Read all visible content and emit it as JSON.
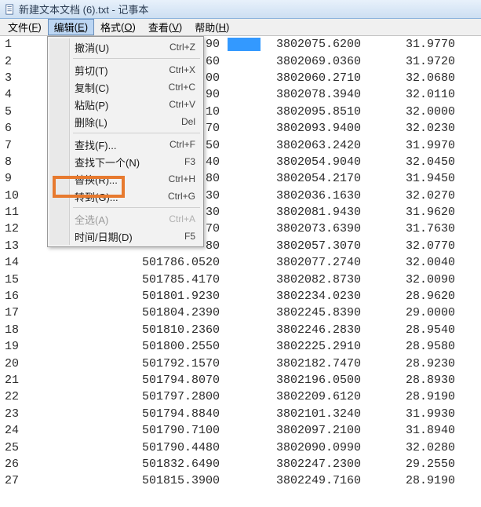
{
  "window": {
    "title": "新建文本文档 (6).txt - 记事本"
  },
  "menubar": {
    "file": {
      "label": "文件",
      "mn": "F"
    },
    "edit": {
      "label": "编辑",
      "mn": "E"
    },
    "format": {
      "label": "格式",
      "mn": "O"
    },
    "view": {
      "label": "查看",
      "mn": "V"
    },
    "help": {
      "label": "帮助",
      "mn": "H"
    }
  },
  "edit_menu": {
    "undo": {
      "label": "撤消(U)",
      "accel": "Ctrl+Z",
      "enabled": true
    },
    "cut": {
      "label": "剪切(T)",
      "accel": "Ctrl+X",
      "enabled": true
    },
    "copy": {
      "label": "复制(C)",
      "accel": "Ctrl+C",
      "enabled": true
    },
    "paste": {
      "label": "粘贴(P)",
      "accel": "Ctrl+V",
      "enabled": true
    },
    "delete": {
      "label": "删除(L)",
      "accel": "Del",
      "enabled": true
    },
    "find": {
      "label": "查找(F)...",
      "accel": "Ctrl+F",
      "enabled": true
    },
    "findnext": {
      "label": "查找下一个(N)",
      "accel": "F3",
      "enabled": true
    },
    "replace": {
      "label": "替换(R)...",
      "accel": "Ctrl+H",
      "enabled": true
    },
    "goto": {
      "label": "转到(G)...",
      "accel": "Ctrl+G",
      "enabled": true
    },
    "selectall": {
      "label": "全选(A)",
      "accel": "Ctrl+A",
      "enabled": false
    },
    "timedate": {
      "label": "时间/日期(D)",
      "accel": "F5",
      "enabled": true
    }
  },
  "rows": [
    {
      "n": "1",
      "c1": "90",
      "c2": "3802075.6200",
      "c3": "31.9770",
      "sel": true
    },
    {
      "n": "2",
      "c1": "60",
      "c2": "3802069.0360",
      "c3": "31.9720"
    },
    {
      "n": "3",
      "c1": "00",
      "c2": "3802060.2710",
      "c3": "32.0680"
    },
    {
      "n": "4",
      "c1": "90",
      "c2": "3802078.3940",
      "c3": "32.0110"
    },
    {
      "n": "5",
      "c1": "10",
      "c2": "3802095.8510",
      "c3": "32.0000"
    },
    {
      "n": "6",
      "c1": "70",
      "c2": "3802093.9400",
      "c3": "32.0230"
    },
    {
      "n": "7",
      "c1": "50",
      "c2": "3802063.2420",
      "c3": "31.9970"
    },
    {
      "n": "8",
      "c1": "40",
      "c2": "3802054.9040",
      "c3": "32.0450"
    },
    {
      "n": "9",
      "c1": "80",
      "c2": "3802054.2170",
      "c3": "31.9450"
    },
    {
      "n": "10",
      "c1": "30",
      "c2": "3802036.1630",
      "c3": "32.0270"
    },
    {
      "n": "11",
      "c1": "30",
      "c2": "3802081.9430",
      "c3": "31.9620"
    },
    {
      "n": "12",
      "c1": "70",
      "c2": "3802073.6390",
      "c3": "31.7630"
    },
    {
      "n": "13",
      "c1": "80",
      "c2": "3802057.3070",
      "c3": "32.0770"
    },
    {
      "n": "14",
      "c1": "501786.0520",
      "c2": "3802077.2740",
      "c3": "32.0040"
    },
    {
      "n": "15",
      "c1": "501785.4170",
      "c2": "3802082.8730",
      "c3": "32.0090"
    },
    {
      "n": "16",
      "c1": "501801.9230",
      "c2": "3802234.0230",
      "c3": "28.9620"
    },
    {
      "n": "17",
      "c1": "501804.2390",
      "c2": "3802245.8390",
      "c3": "29.0000"
    },
    {
      "n": "18",
      "c1": "501810.2360",
      "c2": "3802246.2830",
      "c3": "28.9540"
    },
    {
      "n": "19",
      "c1": "501800.2550",
      "c2": "3802225.2910",
      "c3": "28.9580"
    },
    {
      "n": "20",
      "c1": "501792.1570",
      "c2": "3802182.7470",
      "c3": "28.9230"
    },
    {
      "n": "21",
      "c1": "501794.8070",
      "c2": "3802196.0500",
      "c3": "28.8930"
    },
    {
      "n": "22",
      "c1": "501797.2800",
      "c2": "3802209.6120",
      "c3": "28.9190"
    },
    {
      "n": "23",
      "c1": "501794.8840",
      "c2": "3802101.3240",
      "c3": "31.9930"
    },
    {
      "n": "24",
      "c1": "501790.7100",
      "c2": "3802097.2100",
      "c3": "31.8940"
    },
    {
      "n": "25",
      "c1": "501790.4480",
      "c2": "3802090.0990",
      "c3": "32.0280"
    },
    {
      "n": "26",
      "c1": "501832.6490",
      "c2": "3802247.2300",
      "c3": "29.2550"
    },
    {
      "n": "27",
      "c1": "501815.3900",
      "c2": "3802249.7160",
      "c3": "28.9190"
    }
  ]
}
